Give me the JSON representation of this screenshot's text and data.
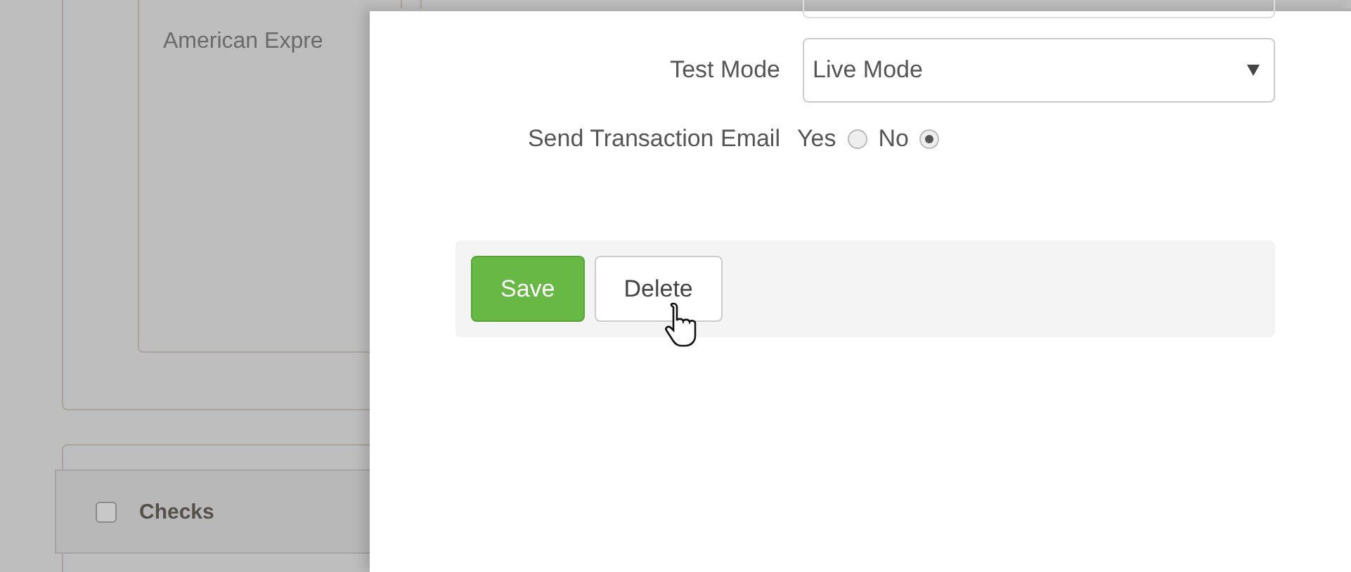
{
  "background": {
    "card_text": "American Expre",
    "section": {
      "label": "Checks",
      "checked": false
    }
  },
  "modal": {
    "test_mode": {
      "label": "Test Mode",
      "value": "Live Mode"
    },
    "send_email": {
      "label": "Send Transaction Email",
      "options": [
        {
          "label": "Yes",
          "selected": false
        },
        {
          "label": "No",
          "selected": true
        }
      ]
    },
    "buttons": [
      {
        "label": "Save",
        "kind": "primary"
      },
      {
        "label": "Delete",
        "kind": "default"
      }
    ]
  }
}
